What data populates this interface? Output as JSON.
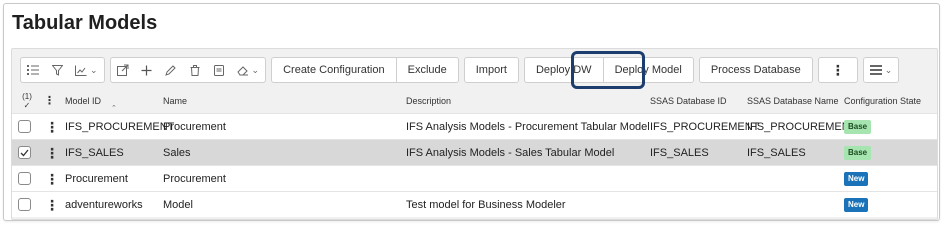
{
  "page": {
    "title": "Tabular Models"
  },
  "toolbar": {
    "icons": [
      "list-icon",
      "filter-icon",
      "chart-icon",
      "export-icon",
      "plus-icon",
      "pencil-icon",
      "trash-icon",
      "copy-icon",
      "eraser-icon"
    ],
    "buttons": {
      "create_configuration": "Create Configuration",
      "exclude": "Exclude",
      "import": "Import",
      "deploy_dw": "Deploy DW",
      "deploy_model": "Deploy Model",
      "process_database": "Process Database"
    }
  },
  "table": {
    "selection_count": "(1)",
    "columns": {
      "model_id": "Model ID",
      "name": "Name",
      "description": "Description",
      "ssas_database_id": "SSAS Database ID",
      "ssas_database_name": "SSAS Database Name",
      "configuration_state": "Configuration State"
    },
    "rows": [
      {
        "model_id": "IFS_PROCUREMENT",
        "name": "Procurement",
        "description": "IFS Analysis Models - Procurement Tabular Model",
        "ssas_database_id": "IFS_PROCUREMENT",
        "ssas_database_name": "IFS_PROCUREMENT",
        "configuration_state": "Base",
        "selected": false
      },
      {
        "model_id": "IFS_SALES",
        "name": "Sales",
        "description": "IFS Analysis Models - Sales Tabular Model",
        "ssas_database_id": "IFS_SALES",
        "ssas_database_name": "IFS_SALES",
        "configuration_state": "Base",
        "selected": true
      },
      {
        "model_id": "Procurement",
        "name": "Procurement",
        "description": "",
        "ssas_database_id": "",
        "ssas_database_name": "",
        "configuration_state": "New",
        "selected": false
      },
      {
        "model_id": "adventureworks",
        "name": "Model",
        "description": "Test model for Business Modeler",
        "ssas_database_id": "",
        "ssas_database_name": "",
        "configuration_state": "New",
        "selected": false
      }
    ]
  },
  "colors": {
    "highlight_border": "#1c3d6e",
    "badge_base": "#a6e4b0",
    "badge_new": "#1a73b8",
    "selected_row": "#d8d8d8"
  }
}
